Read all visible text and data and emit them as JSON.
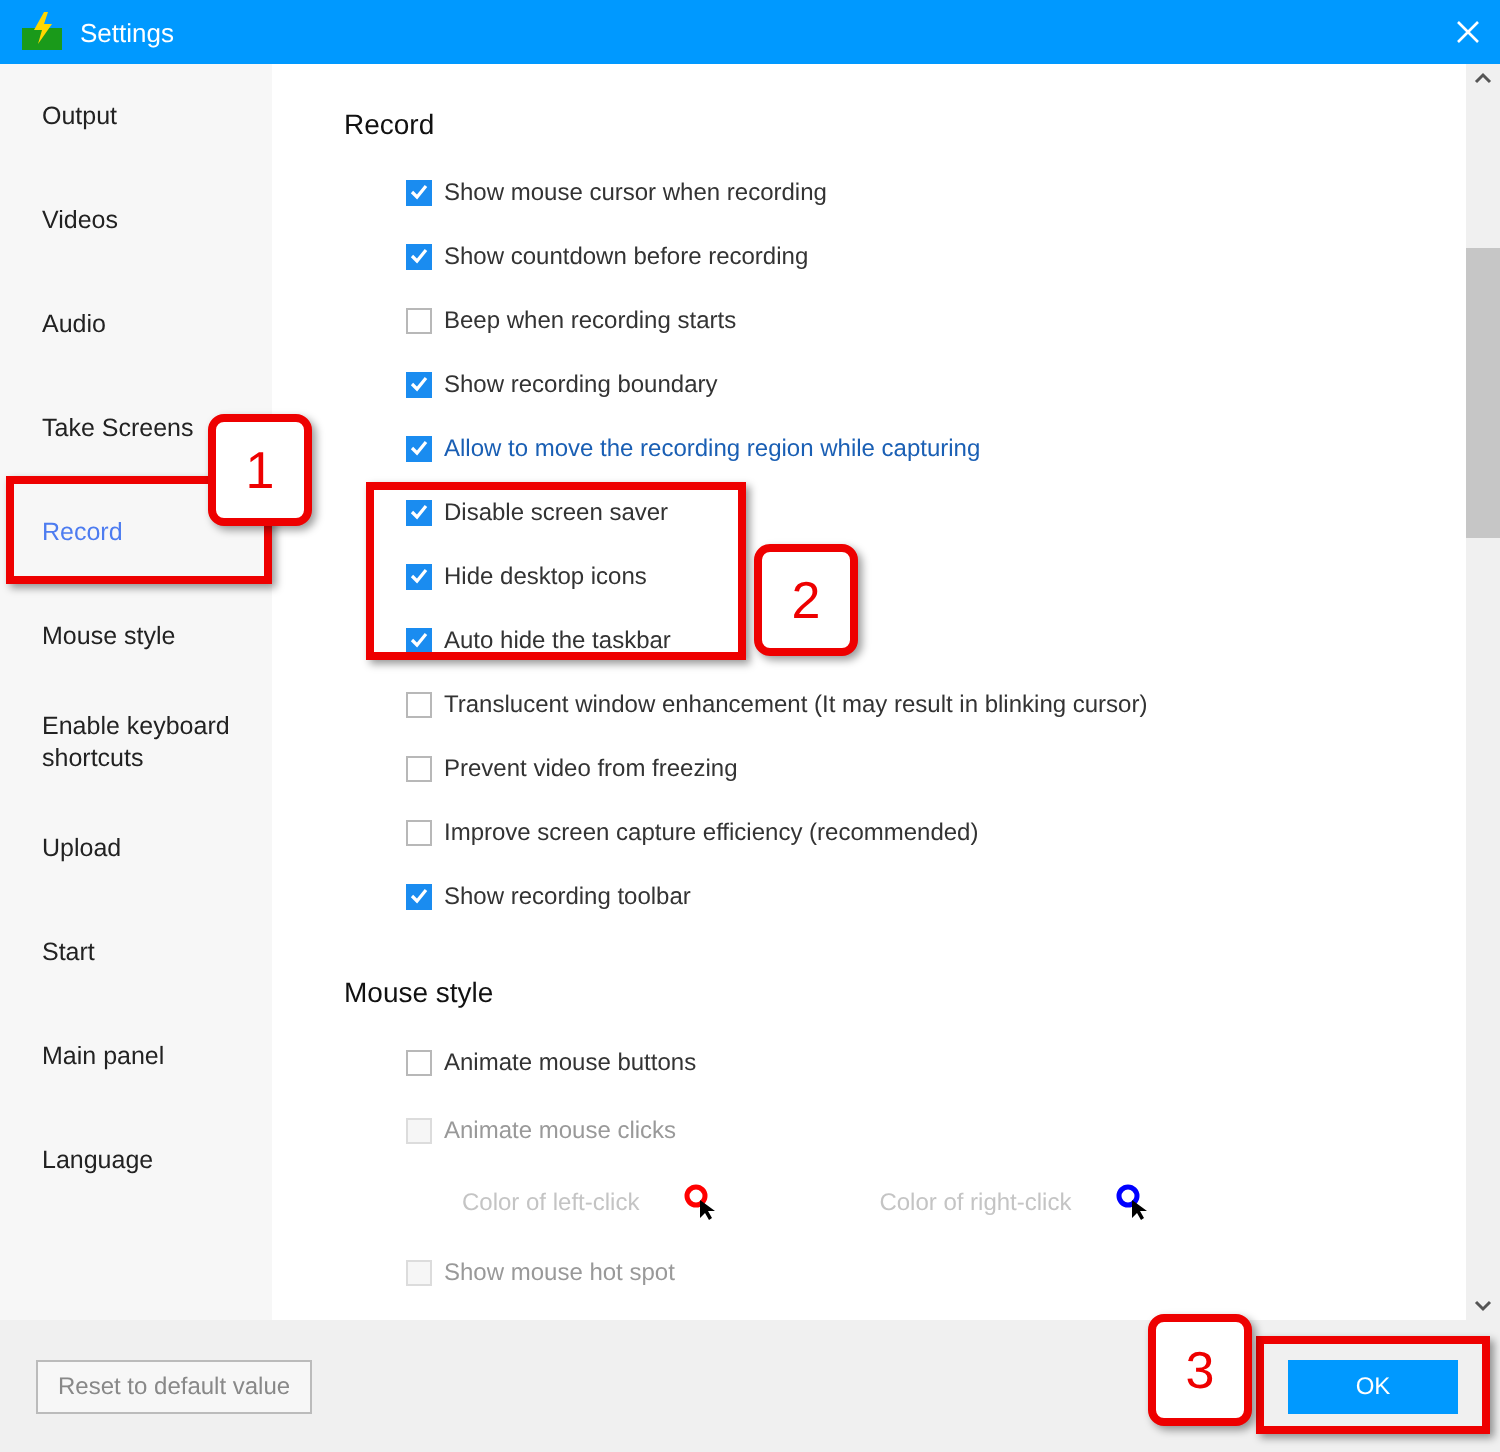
{
  "window": {
    "title": "Settings"
  },
  "sidebar": {
    "items": [
      {
        "label": "Output",
        "selected": false
      },
      {
        "label": "Videos",
        "selected": false
      },
      {
        "label": "Audio",
        "selected": false
      },
      {
        "label": "Take Screens",
        "selected": false
      },
      {
        "label": "Record",
        "selected": true
      },
      {
        "label": "Mouse style",
        "selected": false
      },
      {
        "label": "Enable keyboard shortcuts",
        "selected": false
      },
      {
        "label": "Upload",
        "selected": false
      },
      {
        "label": "Start",
        "selected": false
      },
      {
        "label": "Main panel",
        "selected": false
      },
      {
        "label": "Language",
        "selected": false
      }
    ]
  },
  "sections": [
    {
      "title": "Record",
      "items": [
        {
          "kind": "checkbox",
          "label": "Show mouse cursor when recording",
          "checked": true,
          "highlighted": false,
          "disabled": false
        },
        {
          "kind": "checkbox",
          "label": "Show countdown before recording",
          "checked": true,
          "highlighted": false,
          "disabled": false
        },
        {
          "kind": "checkbox",
          "label": "Beep when recording starts",
          "checked": false,
          "highlighted": false,
          "disabled": false
        },
        {
          "kind": "checkbox",
          "label": "Show recording boundary",
          "checked": true,
          "highlighted": false,
          "disabled": false
        },
        {
          "kind": "checkbox",
          "label": "Allow to move the recording region while capturing",
          "checked": true,
          "highlighted": true,
          "disabled": false
        },
        {
          "kind": "checkbox",
          "label": "Disable screen saver",
          "checked": true,
          "highlighted": false,
          "disabled": false
        },
        {
          "kind": "checkbox",
          "label": "Hide desktop icons",
          "checked": true,
          "highlighted": false,
          "disabled": false
        },
        {
          "kind": "checkbox",
          "label": "Auto hide the taskbar",
          "checked": true,
          "highlighted": false,
          "disabled": false
        },
        {
          "kind": "checkbox",
          "label": "Translucent window enhancement (It may result in blinking cursor)",
          "checked": false,
          "highlighted": false,
          "disabled": false
        },
        {
          "kind": "checkbox",
          "label": "Prevent video from freezing",
          "checked": false,
          "highlighted": false,
          "disabled": false
        },
        {
          "kind": "checkbox",
          "label": "Improve screen capture efficiency (recommended)",
          "checked": false,
          "highlighted": false,
          "disabled": false
        },
        {
          "kind": "checkbox",
          "label": "Show recording toolbar",
          "checked": true,
          "highlighted": false,
          "disabled": false
        }
      ]
    },
    {
      "title": "Mouse style",
      "items": [
        {
          "kind": "checkbox",
          "label": "Animate mouse buttons",
          "checked": false,
          "highlighted": false,
          "disabled": false
        },
        {
          "kind": "checkbox",
          "label": "Animate mouse clicks",
          "checked": false,
          "highlighted": false,
          "disabled": true
        },
        {
          "kind": "colors",
          "colors": [
            {
              "label": "Color of left-click",
              "color": "#ff0000"
            },
            {
              "label": "Color of right-click",
              "color": "#0000ff"
            }
          ]
        },
        {
          "kind": "checkbox",
          "label": "Show mouse hot spot",
          "checked": false,
          "highlighted": false,
          "disabled": true
        }
      ]
    }
  ],
  "footer": {
    "reset_button": "Reset to default value",
    "ok_button": "OK"
  },
  "annotations": [
    "1",
    "2",
    "3"
  ]
}
